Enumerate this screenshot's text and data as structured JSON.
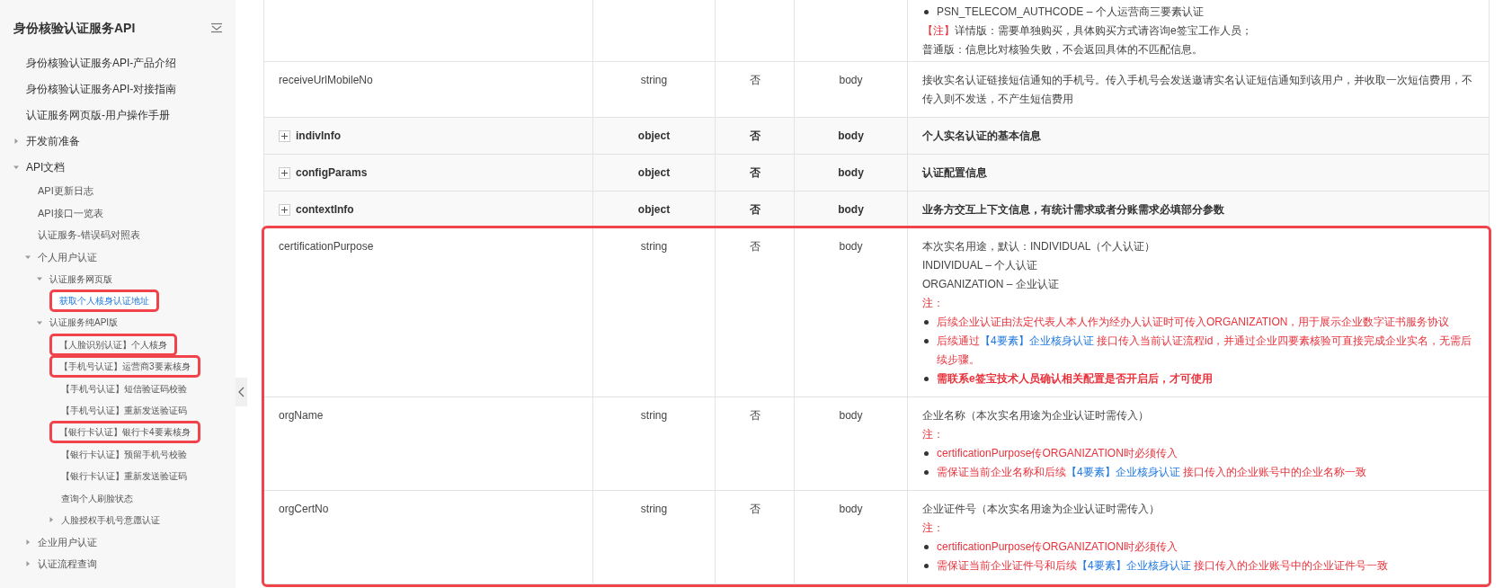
{
  "sidebar": {
    "title": "身份核验认证服务API",
    "items": [
      {
        "kind": "leaf",
        "label": "身份核验认证服务API-产品介绍",
        "selected": false,
        "highlighted": false
      },
      {
        "kind": "leaf",
        "label": "身份核验认证服务API-对接指南",
        "selected": false,
        "highlighted": false
      },
      {
        "kind": "leaf",
        "label": "认证服务网页版-用户操作手册",
        "selected": false,
        "highlighted": false
      },
      {
        "kind": "folder",
        "label": "开发前准备",
        "expanded": false,
        "selected": false,
        "highlighted": false
      },
      {
        "kind": "folder",
        "label": "API文档",
        "expanded": true,
        "selected": false,
        "highlighted": false,
        "children": [
          {
            "kind": "leaf",
            "label": "API更新日志",
            "selected": false,
            "highlighted": false
          },
          {
            "kind": "leaf",
            "label": "API接口一览表",
            "selected": false,
            "highlighted": false
          },
          {
            "kind": "leaf",
            "label": "认证服务-错误码对照表",
            "selected": false,
            "highlighted": false
          },
          {
            "kind": "folder",
            "label": "个人用户认证",
            "expanded": true,
            "selected": false,
            "highlighted": false,
            "children": [
              {
                "kind": "folder",
                "label": "认证服务网页版",
                "expanded": true,
                "selected": false,
                "highlighted": false,
                "children": [
                  {
                    "kind": "leaf",
                    "label": "获取个人核身认证地址",
                    "selected": true,
                    "highlighted": true
                  }
                ]
              },
              {
                "kind": "folder",
                "label": "认证服务纯API版",
                "expanded": true,
                "selected": false,
                "highlighted": false,
                "children": [
                  {
                    "kind": "leaf",
                    "label": "【人脸识别认证】个人核身",
                    "selected": false,
                    "highlighted": true
                  },
                  {
                    "kind": "leaf",
                    "label": "【手机号认证】运营商3要素核身",
                    "selected": false,
                    "highlighted": true
                  },
                  {
                    "kind": "leaf",
                    "label": "【手机号认证】短信验证码校验",
                    "selected": false,
                    "highlighted": false
                  },
                  {
                    "kind": "leaf",
                    "label": "【手机号认证】重新发送验证码",
                    "selected": false,
                    "highlighted": false
                  },
                  {
                    "kind": "leaf",
                    "label": "【银行卡认证】银行卡4要素核身",
                    "selected": false,
                    "highlighted": true
                  },
                  {
                    "kind": "leaf",
                    "label": "【银行卡认证】预留手机号校验",
                    "selected": false,
                    "highlighted": false
                  },
                  {
                    "kind": "leaf",
                    "label": "【银行卡认证】重新发送验证码",
                    "selected": false,
                    "highlighted": false
                  },
                  {
                    "kind": "leaf",
                    "label": "查询个人刷脸状态",
                    "selected": false,
                    "highlighted": false
                  },
                  {
                    "kind": "folder",
                    "label": "人脸授权手机号意愿认证",
                    "expanded": false,
                    "selected": false,
                    "highlighted": false
                  }
                ]
              }
            ]
          },
          {
            "kind": "folder",
            "label": "企业用户认证",
            "expanded": false,
            "selected": false,
            "highlighted": false
          },
          {
            "kind": "folder",
            "label": "认证流程查询",
            "expanded": false,
            "selected": false,
            "highlighted": false
          }
        ]
      }
    ]
  },
  "table": {
    "rows": [
      {
        "kind": "field",
        "highlighted": false,
        "description": [
          {
            "kind": "bullet",
            "parts": [
              {
                "text": "PSN_TELECOM_AUTHCODE – 个人运营商三要素认证",
                "kind": "plain"
              }
            ]
          },
          {
            "kind": "text",
            "parts": [
              {
                "text": "【注】",
                "kind": "red"
              },
              {
                "text": "详情版：需要单独购买，具体购买方式请咨询e签宝工作人员；",
                "kind": "plain"
              }
            ]
          },
          {
            "kind": "text",
            "parts": [
              {
                "text": "普通版：信息比对核验失败，不会返回具体的不匹配信息。",
                "kind": "plain"
              }
            ]
          }
        ]
      },
      {
        "kind": "field",
        "name": "receiveUrlMobileNo",
        "type": "string",
        "required": "否",
        "location": "body",
        "highlighted": false,
        "description": [
          {
            "kind": "text",
            "parts": [
              {
                "text": "接收实名认证链接短信通知的手机号。传入手机号会发送邀请实名认证短信通知到该用户，并收取一次短信费用，不传入则不发送，不产生短信费用",
                "kind": "plain"
              }
            ]
          }
        ]
      },
      {
        "kind": "object",
        "name": "indivInfo",
        "type": "object",
        "required": "否",
        "location": "body",
        "expanded": false,
        "highlighted": false,
        "description": [
          {
            "kind": "text",
            "parts": [
              {
                "text": "个人实名认证的基本信息",
                "kind": "plain"
              }
            ]
          }
        ]
      },
      {
        "kind": "object",
        "name": "configParams",
        "type": "object",
        "required": "否",
        "location": "body",
        "expanded": false,
        "highlighted": false,
        "description": [
          {
            "kind": "text",
            "parts": [
              {
                "text": "认证配置信息",
                "kind": "plain"
              }
            ]
          }
        ]
      },
      {
        "kind": "object",
        "name": "contextInfo",
        "type": "object",
        "required": "否",
        "location": "body",
        "expanded": false,
        "highlighted": false,
        "description": [
          {
            "kind": "text",
            "parts": [
              {
                "text": "业务方交互上下文信息，有统计需求或者分账需求必填部分参数",
                "kind": "plain"
              }
            ]
          }
        ]
      },
      {
        "kind": "field",
        "name": "certificationPurpose",
        "type": "string",
        "required": "否",
        "location": "body",
        "highlighted": true,
        "description": [
          {
            "kind": "text",
            "parts": [
              {
                "text": "本次实名用途，默认：INDIVIDUAL（个人认证）",
                "kind": "plain"
              }
            ]
          },
          {
            "kind": "text",
            "parts": [
              {
                "text": "INDIVIDUAL – 个人认证",
                "kind": "plain"
              }
            ]
          },
          {
            "kind": "text",
            "parts": [
              {
                "text": "ORGANIZATION – 企业认证",
                "kind": "plain"
              }
            ]
          },
          {
            "kind": "text",
            "parts": [
              {
                "text": "注：",
                "kind": "red"
              }
            ]
          },
          {
            "kind": "bullet",
            "parts": [
              {
                "text": "后续企业认证由法定代表人本人作为经办人认证时可传入ORGANIZATION，用于展示企业数字证书服务协议",
                "kind": "red"
              }
            ]
          },
          {
            "kind": "bullet",
            "parts": [
              {
                "text": "后续通过",
                "kind": "red"
              },
              {
                "text": "【4要素】企业核身认证",
                "kind": "link"
              },
              {
                "text": " 接口传入当前认证流程id，并通过企业四要素核验可直接完成企业实名，无需后续步骤。",
                "kind": "red"
              }
            ]
          },
          {
            "kind": "bullet",
            "parts": [
              {
                "text": "需联系e签宝技术人员确认相关配置是否开启后，才可使用",
                "kind": "red_bold"
              }
            ]
          }
        ]
      },
      {
        "kind": "field",
        "name": "orgName",
        "type": "string",
        "required": "否",
        "location": "body",
        "highlighted": true,
        "description": [
          {
            "kind": "text",
            "parts": [
              {
                "text": "企业名称（本次实名用途为企业认证时需传入）",
                "kind": "plain"
              }
            ]
          },
          {
            "kind": "text",
            "parts": [
              {
                "text": "注：",
                "kind": "red"
              }
            ]
          },
          {
            "kind": "bullet",
            "parts": [
              {
                "text": "certificationPurpose传ORGANIZATION时必须传入",
                "kind": "red"
              }
            ]
          },
          {
            "kind": "bullet",
            "parts": [
              {
                "text": "需保证当前企业名称和后续",
                "kind": "red"
              },
              {
                "text": "【4要素】企业核身认证",
                "kind": "link"
              },
              {
                "text": " 接口传入的企业账号中的企业名称一致",
                "kind": "red"
              }
            ]
          }
        ]
      },
      {
        "kind": "field",
        "name": "orgCertNo",
        "type": "string",
        "required": "否",
        "location": "body",
        "highlighted": true,
        "description": [
          {
            "kind": "text",
            "parts": [
              {
                "text": "企业证件号（本次实名用途为企业认证时需传入）",
                "kind": "plain"
              }
            ]
          },
          {
            "kind": "text",
            "parts": [
              {
                "text": "注：",
                "kind": "red"
              }
            ]
          },
          {
            "kind": "bullet",
            "parts": [
              {
                "text": "certificationPurpose传ORGANIZATION时必须传入",
                "kind": "red"
              }
            ]
          },
          {
            "kind": "bullet",
            "parts": [
              {
                "text": "需保证当前企业证件号和后续",
                "kind": "red"
              },
              {
                "text": "【4要素】企业核身认证",
                "kind": "link"
              },
              {
                "text": " 接口传入的企业账号中的企业证件号一致",
                "kind": "red"
              }
            ]
          }
        ]
      }
    ]
  }
}
